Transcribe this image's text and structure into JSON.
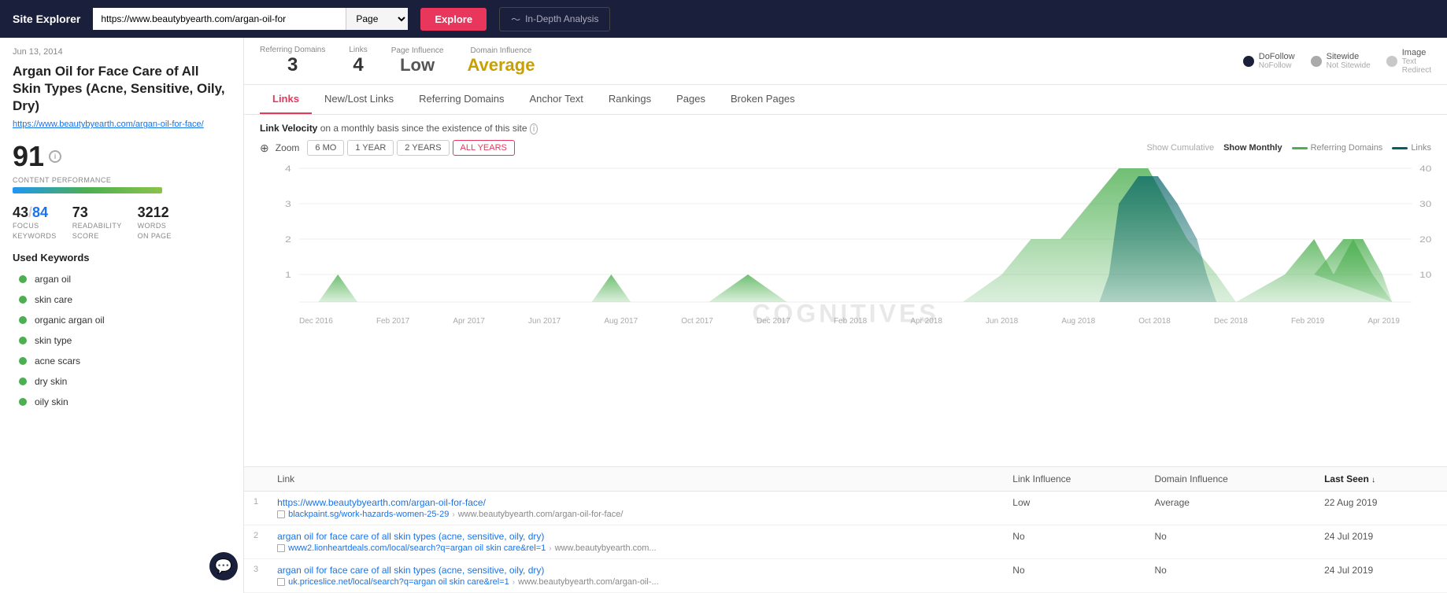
{
  "topbar": {
    "site_explorer_label": "Site Explorer",
    "url_value": "https://www.beautybyearth.com/argan-oil-for",
    "page_select": "Page",
    "explore_btn": "Explore",
    "in_depth_btn": "In-Depth Analysis"
  },
  "sidebar": {
    "date": "Jun 13, 2014",
    "title": "Argan Oil for Face Care of All Skin Types (Acne, Sensitive, Oily, Dry)",
    "url": "https://www.beautybyearth.com/argan-oil-for-face/",
    "perf_score": "91",
    "content_perf_label": "CONTENT PERFORMANCE",
    "focus_keywords": "43",
    "focus_keywords_total": "84",
    "readability_score": "73",
    "words_on_page": "3212",
    "focus_label": "FOCUS\nKEYWORDS",
    "readability_label": "READABILITY\nSCORE",
    "words_label": "WORDS\nON PAGE",
    "used_keywords_label": "Used Keywords",
    "keywords": [
      {
        "text": "argan oil"
      },
      {
        "text": "skin care"
      },
      {
        "text": "organic argan oil"
      },
      {
        "text": "skin type"
      },
      {
        "text": "acne scars"
      },
      {
        "text": "dry skin"
      },
      {
        "text": "oily skin"
      }
    ]
  },
  "statsbar": {
    "referring_domains_label": "Referring Domains",
    "referring_domains_value": "3",
    "links_label": "Links",
    "links_value": "4",
    "page_influence_label": "Page Influence",
    "page_influence_value": "Low",
    "domain_influence_label": "Domain Influence",
    "domain_influence_value": "Average",
    "dofollow_label": "DoFollow",
    "nofollow_label": "NoFollow",
    "sitewide_label": "Sitewide",
    "not_sitewide_label": "Not Sitewide",
    "image_label": "Image",
    "text_label": "Text",
    "redirect_label": "Redirect"
  },
  "tabs": [
    {
      "label": "Links",
      "active": true
    },
    {
      "label": "New/Lost Links",
      "active": false
    },
    {
      "label": "Referring Domains",
      "active": false
    },
    {
      "label": "Anchor Text",
      "active": false
    },
    {
      "label": "Rankings",
      "active": false
    },
    {
      "label": "Pages",
      "active": false
    },
    {
      "label": "Broken Pages",
      "active": false
    }
  ],
  "chart": {
    "title": "Link Velocity",
    "subtitle": "on a monthly basis since the existence of this site",
    "zoom_btns": [
      "6 MO",
      "1 YEAR",
      "2 YEARS",
      "ALL YEARS"
    ],
    "active_zoom": "ALL YEARS",
    "show_cumulative": "Show Cumulative",
    "show_monthly": "Show Monthly",
    "legend_referring": "Referring Domains",
    "legend_links": "Links",
    "watermark": "COGNITIVES",
    "y_left_labels": [
      "4",
      "3",
      "2",
      "1"
    ],
    "y_right_labels": [
      "40",
      "30",
      "20",
      "10"
    ],
    "x_labels": [
      "Dec 2016",
      "Feb 2017",
      "Apr 2017",
      "Jun 2017",
      "Aug 2017",
      "Oct 2017",
      "Dec 2017",
      "Feb 2018",
      "Apr 2018",
      "Jun 2018",
      "Aug 2018",
      "Oct 2018",
      "Dec 2018",
      "Feb 2019",
      "Apr 2019"
    ]
  },
  "table": {
    "col_link": "Link",
    "col_link_influence": "Link Influence",
    "col_domain_influence": "Domain Influence",
    "col_last_seen": "Last Seen",
    "rows": [
      {
        "num": "1",
        "link_text": "https://www.beautybyearth.com/argan-oil-for-face/",
        "source_url": "blackpaint.sg/work-hazards-women-25-29",
        "dest_url": "www.beautybyearth.com/argan-oil-for-face/",
        "link_influence": "Low",
        "domain_influence": "Average",
        "last_seen": "22 Aug 2019"
      },
      {
        "num": "2",
        "link_text": "argan oil for face care of all skin types (acne, sensitive, oily, dry)",
        "source_url": "www2.lionheartdeals.com/local/search?q=argan oil skin care&rel=1",
        "dest_url": "www.beautybyearth.com...",
        "link_influence": "No",
        "domain_influence": "No",
        "last_seen": "24 Jul 2019"
      },
      {
        "num": "3",
        "link_text": "argan oil for face care of all skin types (acne, sensitive, oily, dry)",
        "source_url": "uk.priceslice.net/local/search?q=argan oil skin care&rel=1",
        "dest_url": "www.beautybyearth.com/argan-oil-...",
        "link_influence": "No",
        "domain_influence": "No",
        "last_seen": "24 Jul 2019"
      }
    ]
  }
}
